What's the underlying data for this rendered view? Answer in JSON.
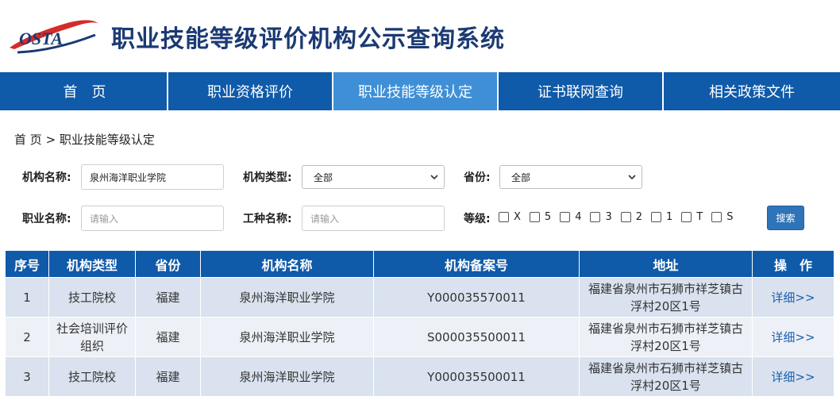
{
  "logo": {
    "text": "OSTA",
    "icon": "osta-logo-icon"
  },
  "header": {
    "title": "职业技能等级评价机构公示查询系统"
  },
  "nav": {
    "items": [
      {
        "label": "首　页",
        "active": false
      },
      {
        "label": "职业资格评价",
        "active": false
      },
      {
        "label": "职业技能等级认定",
        "active": true
      },
      {
        "label": "证书联网查询",
        "active": false
      },
      {
        "label": "相关政策文件",
        "active": false
      }
    ]
  },
  "breadcrumb": {
    "home": "首 页",
    "separator": ">",
    "current": "职业技能等级认定"
  },
  "filters": {
    "org_name": {
      "label": "机构名称:",
      "value": "泉州海洋职业学院"
    },
    "org_type": {
      "label": "机构类型:",
      "value": "全部"
    },
    "province": {
      "label": "省份:",
      "value": "全部"
    },
    "occupation": {
      "label": "职业名称:",
      "placeholder": "请输入"
    },
    "job_type": {
      "label": "工种名称:",
      "placeholder": "请输入"
    },
    "level": {
      "label": "等级:",
      "options": [
        "X",
        "5",
        "4",
        "3",
        "2",
        "1",
        "T",
        "S"
      ]
    },
    "search_label": "搜索"
  },
  "table": {
    "headers": [
      "序号",
      "机构类型",
      "省份",
      "机构名称",
      "机构备案号",
      "地址",
      "操　作"
    ],
    "rows": [
      {
        "no": "1",
        "type": "技工院校",
        "province": "福建",
        "name": "泉州海洋职业学院",
        "record": "Y000035570011",
        "address": "福建省泉州市石狮市祥芝镇古浮村20区1号",
        "action": "详细>>"
      },
      {
        "no": "2",
        "type": "社会培训评价组织",
        "province": "福建",
        "name": "泉州海洋职业学院",
        "record": "S000035500011",
        "address": "福建省泉州市石狮市祥芝镇古浮村20区1号",
        "action": "详细>>"
      },
      {
        "no": "3",
        "type": "技工院校",
        "province": "福建",
        "name": "泉州海洋职业学院",
        "record": "Y000035500011",
        "address": "福建省泉州市石狮市祥芝镇古浮村20区1号",
        "action": "详细>>"
      }
    ]
  },
  "colors": {
    "nav": "#0f5aa9",
    "nav_active": "#3f8fd6",
    "title": "#1b3a73",
    "row_odd": "#d9e2ee",
    "row_even": "#edf1f7",
    "link": "#1b5fae"
  }
}
